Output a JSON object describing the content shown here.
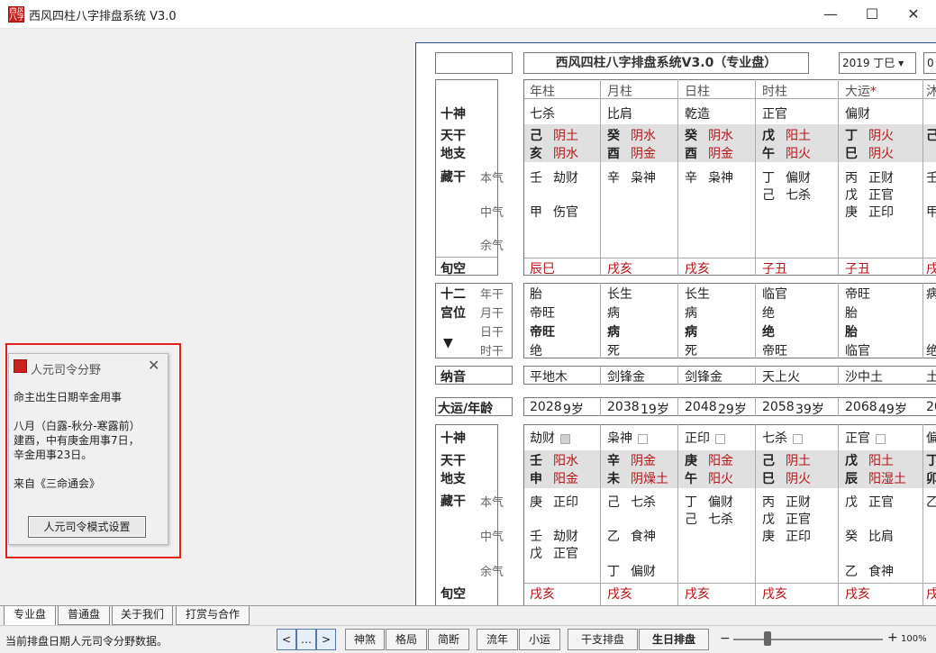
{
  "window": {
    "title": "西风四柱八字排盘系统 V3.0",
    "icon_text": "西风\n八字"
  },
  "board": {
    "title": "西风四柱八字排盘系统V3.0（专业盘）",
    "year_select": "2019 丁巳",
    "extra_select": "0",
    "columns": [
      "年柱",
      "月柱",
      "日柱",
      "时柱",
      "大运"
    ],
    "dayun_star": "*",
    "row_labels": {
      "shishen": "十神",
      "tiangan": "天干",
      "dizhi": "地支",
      "canggan": "藏干",
      "benqi": "本气",
      "zhongqi": "中气",
      "yuqi": "余气",
      "xunkong": "旬空",
      "shier": "十二",
      "gongwei": "宫位",
      "niangan": "年干",
      "yuegan": "月干",
      "rigan": "日干",
      "shigan": "时干",
      "nayin": "纳音",
      "dayun_nianling": "大运/年龄"
    },
    "shishen": [
      "七杀",
      "比肩",
      "乾造",
      "正官",
      "偏财"
    ],
    "gan": [
      [
        "己",
        "阴土"
      ],
      [
        "癸",
        "阴水"
      ],
      [
        "癸",
        "阴水"
      ],
      [
        "戊",
        "阳土"
      ],
      [
        "丁",
        "阴火"
      ]
    ],
    "zhi": [
      [
        "亥",
        "阴水"
      ],
      [
        "酉",
        "阴金"
      ],
      [
        "酉",
        "阴金"
      ],
      [
        "午",
        "阳火"
      ],
      [
        "巳",
        "阴火"
      ]
    ],
    "benqi": [
      [
        "壬",
        "劫财"
      ],
      [
        "辛",
        "枭神"
      ],
      [
        "辛",
        "枭神"
      ],
      [
        "丁",
        "偏财"
      ],
      [
        "丙",
        "正财"
      ]
    ],
    "benqi2": [
      [
        "",
        "",
        ""
      ],
      [
        "",
        "",
        ""
      ],
      [
        "",
        "",
        ""
      ],
      [
        "己",
        "七杀"
      ],
      [
        "戊",
        "正官"
      ]
    ],
    "zhongqi": [
      [
        "甲",
        "伤官"
      ],
      [
        "",
        ""
      ],
      [
        "",
        ""
      ],
      [
        "",
        ""
      ],
      [
        "庚",
        "正印"
      ]
    ],
    "xunkong": [
      "辰巳",
      "戌亥",
      "戌亥",
      "子丑",
      "子丑"
    ],
    "gongwei": [
      [
        "胎",
        "帝旺",
        "帝旺",
        "绝"
      ],
      [
        "长生",
        "病",
        "病",
        "死"
      ],
      [
        "长生",
        "病",
        "病",
        "死"
      ],
      [
        "临官",
        "绝",
        "绝",
        "帝旺"
      ],
      [
        "帝旺",
        "胎",
        "胎",
        "临官"
      ]
    ],
    "nayin": [
      "平地木",
      "剑锋金",
      "剑锋金",
      "天上火",
      "沙中土"
    ],
    "dayun_years": [
      [
        "2028",
        "9岁"
      ],
      [
        "2038",
        "19岁"
      ],
      [
        "2048",
        "29岁"
      ],
      [
        "2058",
        "39岁"
      ],
      [
        "2068",
        "49岁"
      ]
    ],
    "dy_shishen": [
      "劫财",
      "枭神",
      "正印",
      "七杀",
      "正官"
    ],
    "dy_gan": [
      [
        "壬",
        "阳水"
      ],
      [
        "辛",
        "阴金"
      ],
      [
        "庚",
        "阳金"
      ],
      [
        "己",
        "阴土"
      ],
      [
        "戊",
        "阳土"
      ]
    ],
    "dy_zhi": [
      [
        "申",
        "阳金"
      ],
      [
        "未",
        "阴燥土"
      ],
      [
        "午",
        "阳火"
      ],
      [
        "巳",
        "阴火"
      ],
      [
        "辰",
        "阳湿土"
      ]
    ],
    "dy_benqi": [
      [
        "庚",
        "正印"
      ],
      [
        "己",
        "七杀"
      ],
      [
        "丁",
        "偏财"
      ],
      [
        "丙",
        "正财"
      ],
      [
        "戊",
        "正官"
      ]
    ],
    "dy_benqi2": [
      [
        "",
        ""
      ],
      [
        "",
        ""
      ],
      [
        "己",
        "七杀"
      ],
      [
        "戊",
        "正官"
      ],
      [
        "",
        ""
      ]
    ],
    "dy_zhongqi": [
      [
        "壬",
        "劫财"
      ],
      [
        "乙",
        "食神"
      ],
      [
        "",
        ""
      ],
      [
        "庚",
        "正印"
      ],
      [
        "癸",
        "比肩"
      ]
    ],
    "dy_zhongqi2": [
      [
        "戊",
        "正官"
      ],
      [
        "",
        ""
      ],
      [
        "",
        ""
      ],
      [
        "",
        ""
      ],
      [
        "",
        ""
      ]
    ],
    "dy_yuqi": [
      [
        "",
        ""
      ],
      [
        "丁",
        "偏财"
      ],
      [
        "",
        ""
      ],
      [
        "",
        ""
      ],
      [
        "乙",
        "食神"
      ]
    ],
    "dy_xunkong": [
      "戌亥",
      "戌亥",
      "戌亥",
      "戌亥",
      "戌亥"
    ],
    "partial": {
      "a": "沐",
      "b": "己",
      "c": "壬",
      "d": "甲",
      "e": "戌",
      "f": "病",
      "g": "死",
      "h": "绝",
      "i": "土",
      "j": "20",
      "k": "偏",
      "l": "丁",
      "m": "卯",
      "n": "乙",
      "o": "戌"
    }
  },
  "popup": {
    "title": "人元司令分野",
    "close": "✕",
    "body": "命主出生日期辛金用事\n\n八月（白露-秋分-寒露前）\n建酉，中有庚金用事7日，\n辛金用事23日。\n\n来自《三命通会》",
    "button": "人元司令模式设置"
  },
  "tabs": [
    "专业盘",
    "普通盘",
    "关于我们",
    "打赏与合作"
  ],
  "status": {
    "text": "当前排盘日期人元司令分野数据。",
    "nav": [
      "<",
      "…",
      ">"
    ],
    "buttons": [
      "神煞",
      "格局",
      "简断",
      "流年",
      "小运",
      "干支排盘",
      "生日排盘"
    ],
    "zoom_minus": "−",
    "zoom_plus": "+",
    "zoom": "100%"
  },
  "colors": {
    "accent_red": "#b4161b",
    "frame_blue": "#2d4f8c",
    "highlight_border": "#e0211c"
  }
}
